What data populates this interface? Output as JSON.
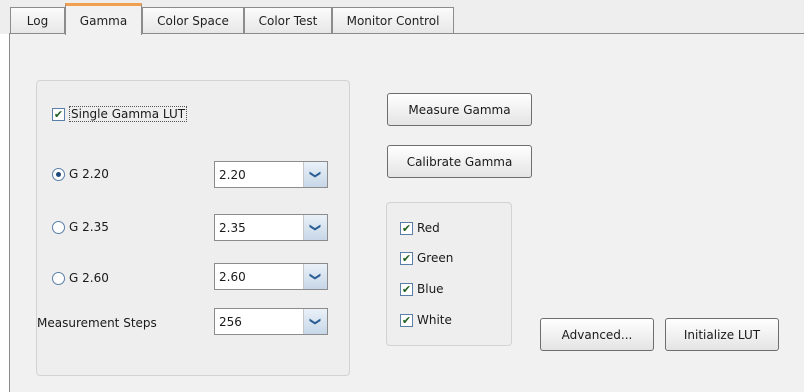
{
  "tabs": [
    {
      "label": "Log"
    },
    {
      "label": "Gamma"
    },
    {
      "label": "Color Space"
    },
    {
      "label": "Color Test"
    },
    {
      "label": "Monitor Control"
    }
  ],
  "active_tab": "Gamma",
  "gamma": {
    "single_lut": {
      "label": "Single Gamma LUT",
      "checked": true
    },
    "options": [
      {
        "label": "G 2.20",
        "selected": true,
        "value": "2.20"
      },
      {
        "label": "G 2.35",
        "selected": false,
        "value": "2.35"
      },
      {
        "label": "G 2.60",
        "selected": false,
        "value": "2.60"
      }
    ],
    "steps": {
      "label": "Measurement Steps",
      "value": "256"
    }
  },
  "buttons": {
    "measure": "Measure Gamma",
    "calibrate": "Calibrate Gamma",
    "advanced": "Advanced...",
    "initialize": "Initialize LUT"
  },
  "channels": [
    {
      "label": "Red",
      "checked": true
    },
    {
      "label": "Green",
      "checked": true
    },
    {
      "label": "Blue",
      "checked": true
    },
    {
      "label": "White",
      "checked": true
    }
  ],
  "icons": {
    "checkmark": "✔",
    "dropdown": "❯"
  }
}
